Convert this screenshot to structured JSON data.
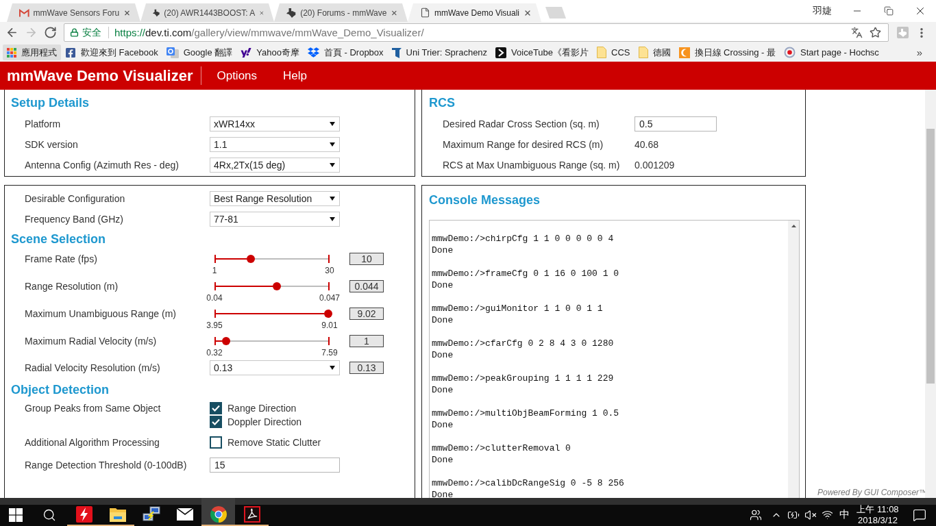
{
  "browser": {
    "tabs": [
      {
        "kind": "mail",
        "title": "mmWave Sensors Foru",
        "selected": false
      },
      {
        "kind": "logo",
        "title": "(20) AWR1443BOOST: A",
        "selected": false
      },
      {
        "kind": "logo",
        "title": "(20) Forums - mmWave",
        "selected": false
      },
      {
        "kind": "page",
        "title": "mmWave Demo Visuali",
        "selected": true
      }
    ],
    "profile_name": "羽婕",
    "nav_buttons": [
      {
        "kind": "back",
        "disabled": false
      },
      {
        "kind": "forward",
        "disabled": true
      },
      {
        "kind": "reload",
        "disabled": false
      }
    ],
    "address_bar": {
      "security_label": "安全",
      "url_scheme": "https://",
      "url_host": "dev.ti.com",
      "url_path": "/gallery/view/mmwave/mmWave_Demo_Visualizer/"
    },
    "bookmarks": [
      {
        "kind": "apps",
        "label": "應用程式"
      },
      {
        "kind": "facebook",
        "label": "歡迎來到 Facebook"
      },
      {
        "kind": "translate",
        "label": "Google 翻譯"
      },
      {
        "kind": "yahoo",
        "label": "Yahoo奇摩"
      },
      {
        "kind": "dropbox",
        "label": "首頁 - Dropbox"
      },
      {
        "kind": "flag",
        "label": "Uni Trier: Sprachenz"
      },
      {
        "kind": "play",
        "label": "VoiceTube《看影片"
      },
      {
        "kind": "folder",
        "label": "CCS"
      },
      {
        "kind": "folder",
        "label": "德國"
      },
      {
        "kind": "crescent",
        "label": "換日線 Crossing - 最"
      },
      {
        "kind": "target",
        "label": "Start page - Hochsc"
      }
    ],
    "bookmarks_more": "»"
  },
  "app": {
    "title": "mmWave Demo Visualizer",
    "menu": [
      "Options",
      "Help"
    ]
  },
  "setup_details": {
    "heading": "Setup Details",
    "fields": [
      {
        "label": "Platform",
        "value": "xWR14xx"
      },
      {
        "label": "SDK version",
        "value": "1.1"
      },
      {
        "label": "Antenna Config (Azimuth Res - deg)",
        "value": "4Rx,2Tx(15 deg)"
      }
    ]
  },
  "rcs": {
    "heading": "RCS",
    "rows": [
      {
        "kind": "input",
        "label": "Desired Radar Cross Section (sq. m)",
        "value": "0.5"
      },
      {
        "kind": "text",
        "label": "Maximum Range for desired RCS (m)",
        "value": "40.68"
      },
      {
        "kind": "text",
        "label": "RCS at Max Unambiguous Range (sq. m)",
        "value": "0.001209"
      }
    ]
  },
  "scene_panel": {
    "fields": [
      {
        "label": "Desirable Configuration",
        "value": "Best Range Resolution"
      },
      {
        "label": "Frequency Band (GHz)",
        "value": "77-81"
      }
    ],
    "scene_selection": {
      "heading": "Scene Selection",
      "rows": [
        {
          "kind": "slider",
          "label": "Frame Rate (fps)",
          "min": "1",
          "max": "30",
          "level": 0.31,
          "reading": "10"
        },
        {
          "kind": "slider",
          "label": "Range Resolution (m)",
          "min": "0.04",
          "max": "0.047",
          "level": 0.54,
          "reading": "0.044"
        },
        {
          "kind": "slider",
          "label": "Maximum Unambiguous Range (m)",
          "min": "3.95",
          "max": "9.01",
          "level": 1,
          "reading": "9.02"
        },
        {
          "kind": "slider",
          "label": "Maximum Radial Velocity (m/s)",
          "min": "0.32",
          "max": "7.59",
          "level": 0.09,
          "reading": "1"
        },
        {
          "kind": "dropdown",
          "label": "Radial Velocity Resolution (m/s)",
          "value": "0.13",
          "reading": "0.13"
        }
      ]
    },
    "object_detection": {
      "heading": "Object Detection",
      "rows": [
        {
          "kind": "checkboxes",
          "label": "Group Peaks from Same Object",
          "options": [
            {
              "label": "Range Direction",
              "checked": true
            },
            {
              "label": "Doppler Direction",
              "checked": true
            }
          ]
        },
        {
          "kind": "checkboxes",
          "label": "Additional Algorithm Processing",
          "options": [
            {
              "label": "Remove Static Clutter",
              "checked": false
            }
          ]
        },
        {
          "kind": "input",
          "label": "Range Detection Threshold (0-100dB)",
          "value": "15"
        }
      ]
    }
  },
  "console": {
    "heading": "Console Messages",
    "entries": [
      {
        "command": "mmwDemo:/>chirpCfg 1 1 0 0 0 0 0 4",
        "response": "Done"
      },
      {
        "command": "mmwDemo:/>frameCfg 0 1 16 0 100 1 0",
        "response": "Done"
      },
      {
        "command": "mmwDemo:/>guiMonitor 1 1 0 0 1 1",
        "response": "Done"
      },
      {
        "command": "mmwDemo:/>cfarCfg 0 2 8 4 3 0 1280",
        "response": "Done"
      },
      {
        "command": "mmwDemo:/>peakGrouping 1 1 1 1 229",
        "response": "Done"
      },
      {
        "command": "mmwDemo:/>multiObjBeamForming 1 0.5",
        "response": "Done"
      },
      {
        "command": "mmwDemo:/>clutterRemoval 0",
        "response": "Done"
      },
      {
        "command": "mmwDemo:/>calibDcRangeSig 0 -5 8 256",
        "response": "Done"
      }
    ]
  },
  "footer": {
    "powered_by": "Powered By GUI Composer™"
  },
  "taskbar": {
    "apps": [
      {
        "kind": "bolt",
        "running": true,
        "selected": false
      },
      {
        "kind": "explorer",
        "running": true,
        "selected": false
      },
      {
        "kind": "network",
        "running": false,
        "selected": false
      },
      {
        "kind": "mail",
        "running": false,
        "selected": false
      },
      {
        "kind": "chrome",
        "running": true,
        "selected": true
      },
      {
        "kind": "pdf",
        "running": true,
        "selected": false
      }
    ],
    "volume_muted": true,
    "input_method": "中",
    "time": "上午 11:08",
    "date": "2018/3/12"
  }
}
